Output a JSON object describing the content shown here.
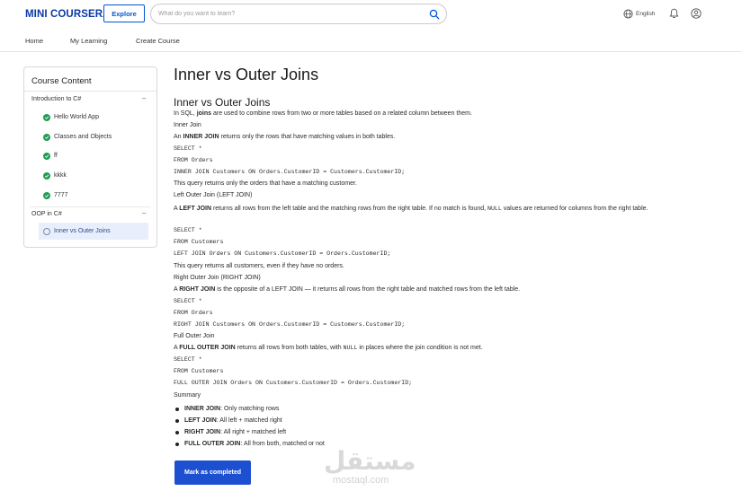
{
  "header": {
    "logo": "MINI COURSERA",
    "explore_label": "Explore",
    "search_placeholder": "What do you want to learn?",
    "language": "English"
  },
  "nav": {
    "items": [
      "Home",
      "My Learning",
      "Create Course"
    ]
  },
  "sidebar": {
    "title": "Course Content",
    "sections": [
      {
        "title": "Introduction to C#",
        "toggle": "–",
        "lessons": [
          "Hello World App",
          "Classes and Objects",
          "ff",
          "kkkk",
          "7777"
        ]
      },
      {
        "title": "OOP in C#",
        "toggle": "–",
        "lessons": [
          "Inner vs Outer Joins"
        ]
      }
    ]
  },
  "content": {
    "page_title": "Inner vs Outer Joins",
    "sub_title": "Inner vs Outer Joins",
    "intro_a": "In SQL, ",
    "intro_b": "joins",
    "intro_c": " are used to combine rows from two or more tables based on a related column between them.",
    "inner_heading": "Inner Join",
    "inner_a": "An ",
    "inner_b": "INNER JOIN",
    "inner_c": " returns only the rows that have matching values in both tables.",
    "inner_code": [
      "SELECT *",
      "FROM Orders",
      "INNER JOIN Customers ON Orders.CustomerID = Customers.CustomerID;"
    ],
    "inner_note": "This query returns only the orders that have a matching customer.",
    "left_heading": "Left Outer Join (LEFT JOIN)",
    "left_a": "A ",
    "left_b": "LEFT JOIN",
    "left_c": " returns all rows from the left table and the matching rows from the right table. If no match is found, ",
    "left_null": "NULL",
    "left_d": " values are returned for columns from the right table.",
    "left_code": [
      "SELECT *",
      "FROM Customers",
      "LEFT JOIN Orders ON Customers.CustomerID = Orders.CustomerID;"
    ],
    "left_note": "This query returns all customers, even if they have no orders.",
    "right_heading": "Right Outer Join (RIGHT JOIN)",
    "right_a": "A ",
    "right_b": "RIGHT JOIN",
    "right_c": " is the opposite of a LEFT JOIN — it returns all rows from the right table and matched rows from the left table.",
    "right_code": [
      "SELECT *",
      "FROM Orders",
      "RIGHT JOIN Customers ON Orders.CustomerID = Customers.CustomerID;"
    ],
    "full_heading": "Full Outer Join",
    "full_a": "A ",
    "full_b": "FULL OUTER JOIN",
    "full_c": " returns all rows from both tables, with ",
    "full_null": "NULL",
    "full_d": " in places where the join condition is not met.",
    "full_code": [
      "SELECT *",
      "FROM Customers",
      "FULL OUTER JOIN Orders ON Customers.CustomerID = Orders.CustomerID;"
    ],
    "summary_heading": "Summary",
    "summary": [
      {
        "term": "INNER JOIN",
        "desc": ": Only matching rows"
      },
      {
        "term": "LEFT JOIN",
        "desc": ": All left + matched right"
      },
      {
        "term": "RIGHT JOIN",
        "desc": ": All right + matched left"
      },
      {
        "term": "FULL OUTER JOIN",
        "desc": ": All from both, matched or not"
      }
    ],
    "complete_label": "Mark as completed"
  },
  "watermark": {
    "arabic": "مستقل",
    "latin": "mostaql.com"
  },
  "colors": {
    "brand": "#0b3aa6",
    "primary_button": "#1d4fd1",
    "check": "#1f9d55",
    "active_lesson_bg": "#e8eefb"
  },
  "icons": {
    "search": "search-icon",
    "language": "globe-icon",
    "notifications": "bell-icon",
    "account": "user-circle-icon",
    "completed": "check-circle-icon",
    "pending": "empty-circle-icon"
  }
}
